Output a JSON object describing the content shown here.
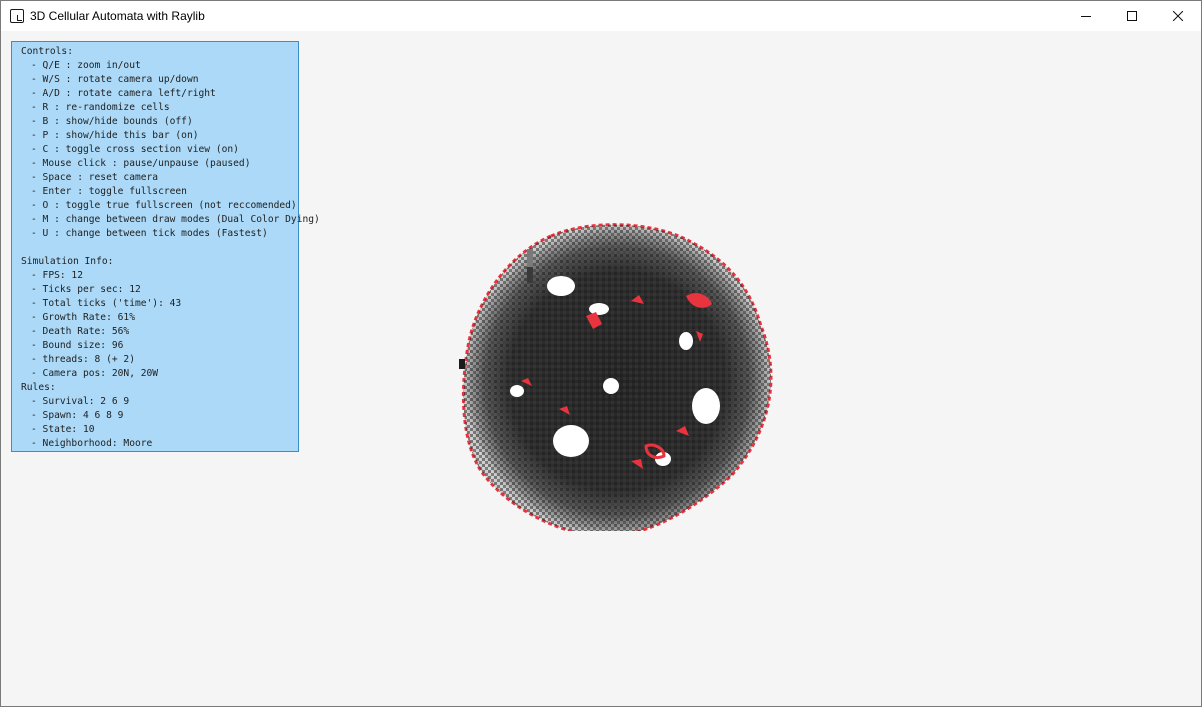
{
  "window": {
    "title": "3D Cellular Automata with Raylib",
    "controls": {
      "minimize": "minimize-icon",
      "maximize": "maximize-icon",
      "close": "close-icon"
    }
  },
  "panel": {
    "controls_heading": "Controls:",
    "controls": [
      "- Q/E : zoom in/out",
      "- W/S : rotate camera up/down",
      "- A/D : rotate camera left/right",
      "- R : re-randomize cells",
      "- B : show/hide bounds (off)",
      "- P : show/hide this bar (on)",
      "- C : toggle cross section view (on)",
      "- Mouse click : pause/unpause (paused)",
      "- Space : reset camera",
      "- Enter : toggle fullscreen",
      "- O : toggle true fullscreen (not reccomended)",
      "- M : change between draw modes (Dual Color Dying)",
      "- U : change between tick modes (Fastest)"
    ],
    "sim_heading": "Simulation Info:",
    "sim_info": [
      "- FPS: 12",
      "- Ticks per sec: 12",
      "- Total ticks ('time'): 43",
      "- Growth Rate: 61%",
      "- Death Rate: 56%",
      "- Bound size: 96",
      "- threads: 8 (+ 2)",
      "- Camera pos: 20N, 20W"
    ],
    "rules_heading": "Rules:",
    "rules": [
      "- Survival: 2 6 9",
      "- Spawn: 4 6 8 9",
      "- State: 10",
      "- Neighborhood: Moore"
    ]
  },
  "colors": {
    "background": "#f5f5f5",
    "panel_bg": "#abd9f7",
    "panel_border": "#3a8fc9",
    "cell_alive": "#2b2b2b",
    "cell_dying": "#e8343f"
  }
}
